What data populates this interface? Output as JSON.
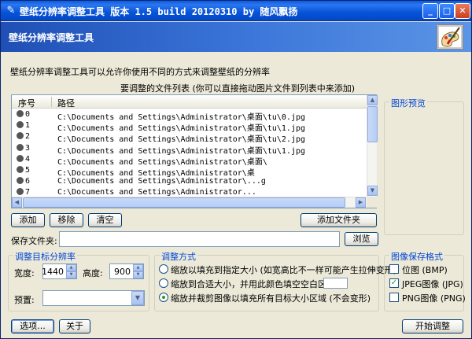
{
  "window": {
    "title": "壁纸分辨率调整工具 版本 1.5 build 20120310 by 随风飘扬",
    "banner": "壁纸分辨率调整工具",
    "description": "壁纸分辨率调整工具可以允许你使用不同的方式来调整壁纸的分辨率"
  },
  "file_list": {
    "title": "要调整的文件列表 (你可以直接拖动图片文件到列表中来添加)",
    "columns": [
      "序号",
      "路径"
    ],
    "rows": [
      {
        "index": "0",
        "path": "C:\\Documents and Settings\\Administrator\\桌面\\tu\\0.jpg"
      },
      {
        "index": "1",
        "path": "C:\\Documents and Settings\\Administrator\\桌面\\tu\\1.jpg"
      },
      {
        "index": "2",
        "path": "C:\\Documents and Settings\\Administrator\\桌面\\tu\\2.jpg"
      },
      {
        "index": "3",
        "path": "C:\\Documents and Settings\\Administrator\\桌面\\tu\\1.jpg"
      },
      {
        "index": "4",
        "path": "C:\\Documents and Settings\\Administrator\\桌面\\"
      },
      {
        "index": "5",
        "path": "C:\\Documents and Settings\\Administrator\\桌"
      },
      {
        "index": "6",
        "path": "C:\\Documents and Settings\\Administrator\\...g"
      },
      {
        "index": "7",
        "path": "C:\\Documents and Settings\\Administrator..."
      }
    ]
  },
  "list_buttons": {
    "add": "添加",
    "remove": "移除",
    "clear": "清空",
    "add_folder": "添加文件夹"
  },
  "preview": {
    "label": "图形预览"
  },
  "save_folder": {
    "label": "保存文件夹:",
    "value": "",
    "browse": "浏览"
  },
  "target_resolution": {
    "group_label": "调整目标分辨率",
    "width_label": "宽度:",
    "width_value": "1440",
    "height_label": "高度:",
    "height_value": "900",
    "preset_label": "预置:",
    "preset_value": ""
  },
  "adjust_method": {
    "group_label": "调整方式",
    "options": [
      {
        "label": "缩放以填充到指定大小 (如宽高比不一样可能产生拉伸变形)",
        "checked": false
      },
      {
        "label": "缩放到合适大小，并用此颜色填空空白区域",
        "checked": false
      },
      {
        "label": "缩放并裁剪图像以填充所有目标大小区域 (不会变形)",
        "checked": true
      }
    ],
    "fill_color": "#ffffff"
  },
  "save_format": {
    "group_label": "图像保存格式",
    "options": [
      {
        "label": "位图 (BMP)",
        "checked": false
      },
      {
        "label": "JPEG图像 (JPG)",
        "checked": true
      },
      {
        "label": "PNG图像 (PNG)",
        "checked": false
      }
    ]
  },
  "footer": {
    "options": "选项...",
    "about": "关于",
    "start": "开始调整"
  },
  "colors": {
    "titlebar": "#0a5be0",
    "group_label": "#0046d5",
    "window_bg": "#ece9d8"
  }
}
